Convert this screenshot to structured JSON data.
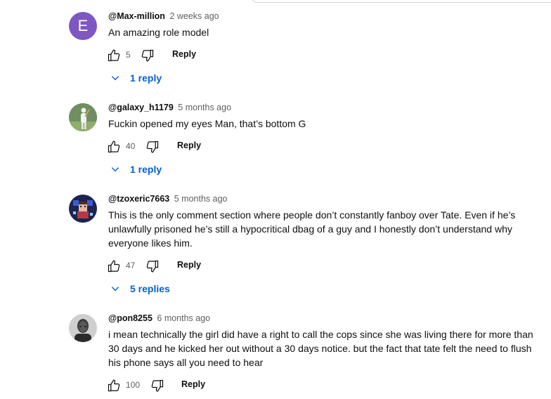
{
  "comments": [
    {
      "avatar": {
        "type": "letter",
        "letter": "E",
        "color": "#7e57c2"
      },
      "author": "@Max-million",
      "time": "2 weeks ago",
      "text": "An amazing role model",
      "likes": "5",
      "reply_label": "Reply",
      "replies_label": "1 reply"
    },
    {
      "avatar": {
        "type": "image",
        "icon": "cricket-player-avatar"
      },
      "author": "@galaxy_h1179",
      "time": "5 months ago",
      "text": "Fuckin opened my eyes Man, that’s bottom G",
      "likes": "40",
      "reply_label": "Reply",
      "replies_label": "1 reply"
    },
    {
      "avatar": {
        "type": "image",
        "icon": "pixel-art-avatar"
      },
      "author": "@tzoxeric7663",
      "time": "5 months ago",
      "text": "This is the only comment section where people don’t constantly fanboy over Tate. Even if he’s unlawfully prisoned he’s still a hypocritical dbag of a guy and I honestly don’t understand why everyone likes him.",
      "likes": "47",
      "reply_label": "Reply",
      "replies_label": "5 replies"
    },
    {
      "avatar": {
        "type": "image",
        "icon": "portrait-avatar"
      },
      "author": "@pon8255",
      "time": "6 months ago",
      "text": "i mean technically the girl did have a right to call the cops since she was living there for more than 30 days and he kicked her out without a 30 days notice. but the fact that tate felt the need to flush his phone says all you need to hear",
      "likes": "100",
      "reply_label": "Reply"
    }
  ],
  "colors": {
    "link_blue": "#065fd4",
    "muted_text": "#606060"
  }
}
